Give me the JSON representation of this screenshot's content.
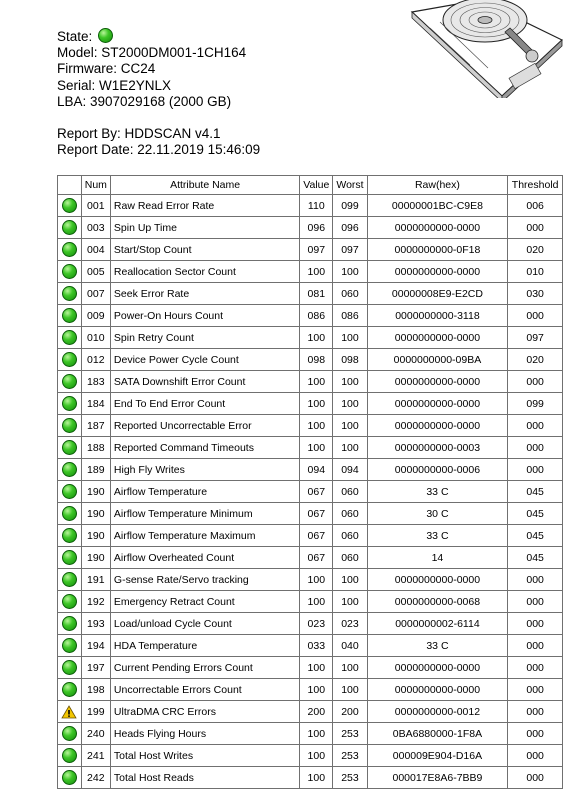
{
  "header": {
    "state_label": "State:",
    "status_icon": "green-circle-icon",
    "model": "Model: ST2000DM001-1CH164",
    "firmware": "Firmware: CC24",
    "serial": "Serial: W1E2YNLX",
    "lba": "LBA: 3907029168 (2000 GB)",
    "report_by": "Report By: HDDSCAN v4.1",
    "report_date": "Report Date: 22.11.2019 15:46:09"
  },
  "colors": {
    "ok": "#2fb51f",
    "warning": "#f0c000"
  },
  "table": {
    "headers": [
      "",
      "Num",
      "Attribute Name",
      "Value",
      "Worst",
      "Raw(hex)",
      "Threshold"
    ],
    "rows": [
      {
        "status": "ok",
        "num": "001",
        "name": "Raw Read Error Rate",
        "value": "110",
        "worst": "099",
        "raw": "00000001BC-C9E8",
        "threshold": "006"
      },
      {
        "status": "ok",
        "num": "003",
        "name": "Spin Up Time",
        "value": "096",
        "worst": "096",
        "raw": "0000000000-0000",
        "threshold": "000"
      },
      {
        "status": "ok",
        "num": "004",
        "name": "Start/Stop Count",
        "value": "097",
        "worst": "097",
        "raw": "0000000000-0F18",
        "threshold": "020"
      },
      {
        "status": "ok",
        "num": "005",
        "name": "Reallocation Sector Count",
        "value": "100",
        "worst": "100",
        "raw": "0000000000-0000",
        "threshold": "010"
      },
      {
        "status": "ok",
        "num": "007",
        "name": "Seek Error Rate",
        "value": "081",
        "worst": "060",
        "raw": "00000008E9-E2CD",
        "threshold": "030"
      },
      {
        "status": "ok",
        "num": "009",
        "name": "Power-On Hours Count",
        "value": "086",
        "worst": "086",
        "raw": "0000000000-3118",
        "threshold": "000"
      },
      {
        "status": "ok",
        "num": "010",
        "name": "Spin Retry Count",
        "value": "100",
        "worst": "100",
        "raw": "0000000000-0000",
        "threshold": "097"
      },
      {
        "status": "ok",
        "num": "012",
        "name": "Device Power Cycle Count",
        "value": "098",
        "worst": "098",
        "raw": "0000000000-09BA",
        "threshold": "020"
      },
      {
        "status": "ok",
        "num": "183",
        "name": "SATA Downshift Error Count",
        "value": "100",
        "worst": "100",
        "raw": "0000000000-0000",
        "threshold": "000"
      },
      {
        "status": "ok",
        "num": "184",
        "name": "End To End Error Count",
        "value": "100",
        "worst": "100",
        "raw": "0000000000-0000",
        "threshold": "099"
      },
      {
        "status": "ok",
        "num": "187",
        "name": "Reported Uncorrectable Error",
        "value": "100",
        "worst": "100",
        "raw": "0000000000-0000",
        "threshold": "000"
      },
      {
        "status": "ok",
        "num": "188",
        "name": "Reported Command Timeouts",
        "value": "100",
        "worst": "100",
        "raw": "0000000000-0003",
        "threshold": "000"
      },
      {
        "status": "ok",
        "num": "189",
        "name": "High Fly Writes",
        "value": "094",
        "worst": "094",
        "raw": "0000000000-0006",
        "threshold": "000"
      },
      {
        "status": "ok",
        "num": "190",
        "name": "Airflow Temperature",
        "value": "067",
        "worst": "060",
        "raw": "33 C",
        "threshold": "045"
      },
      {
        "status": "ok",
        "num": "190",
        "name": "Airflow Temperature Minimum",
        "value": "067",
        "worst": "060",
        "raw": "30 C",
        "threshold": "045"
      },
      {
        "status": "ok",
        "num": "190",
        "name": "Airflow Temperature Maximum",
        "value": "067",
        "worst": "060",
        "raw": "33 C",
        "threshold": "045"
      },
      {
        "status": "ok",
        "num": "190",
        "name": "Airflow Overheated Count",
        "value": "067",
        "worst": "060",
        "raw": "14",
        "threshold": "045"
      },
      {
        "status": "ok",
        "num": "191",
        "name": "G-sense Rate/Servo tracking",
        "value": "100",
        "worst": "100",
        "raw": "0000000000-0000",
        "threshold": "000"
      },
      {
        "status": "ok",
        "num": "192",
        "name": "Emergency Retract Count",
        "value": "100",
        "worst": "100",
        "raw": "0000000000-0068",
        "threshold": "000"
      },
      {
        "status": "ok",
        "num": "193",
        "name": "Load/unload Cycle Count",
        "value": "023",
        "worst": "023",
        "raw": "0000000002-6114",
        "threshold": "000"
      },
      {
        "status": "ok",
        "num": "194",
        "name": "HDA Temperature",
        "value": "033",
        "worst": "040",
        "raw": "33 C",
        "threshold": "000"
      },
      {
        "status": "ok",
        "num": "197",
        "name": "Current Pending Errors Count",
        "value": "100",
        "worst": "100",
        "raw": "0000000000-0000",
        "threshold": "000"
      },
      {
        "status": "ok",
        "num": "198",
        "name": "Uncorrectable Errors Count",
        "value": "100",
        "worst": "100",
        "raw": "0000000000-0000",
        "threshold": "000"
      },
      {
        "status": "warning",
        "num": "199",
        "name": "UltraDMA CRC Errors",
        "value": "200",
        "worst": "200",
        "raw": "0000000000-0012",
        "threshold": "000"
      },
      {
        "status": "ok",
        "num": "240",
        "name": "Heads Flying Hours",
        "value": "100",
        "worst": "253",
        "raw": "0BA6880000-1F8A",
        "threshold": "000"
      },
      {
        "status": "ok",
        "num": "241",
        "name": "Total Host Writes",
        "value": "100",
        "worst": "253",
        "raw": "000009E904-D16A",
        "threshold": "000"
      },
      {
        "status": "ok",
        "num": "242",
        "name": "Total Host Reads",
        "value": "100",
        "worst": "253",
        "raw": "000017E8A6-7BB9",
        "threshold": "000"
      }
    ]
  },
  "image": {
    "icon": "hard-drive-illustration"
  }
}
